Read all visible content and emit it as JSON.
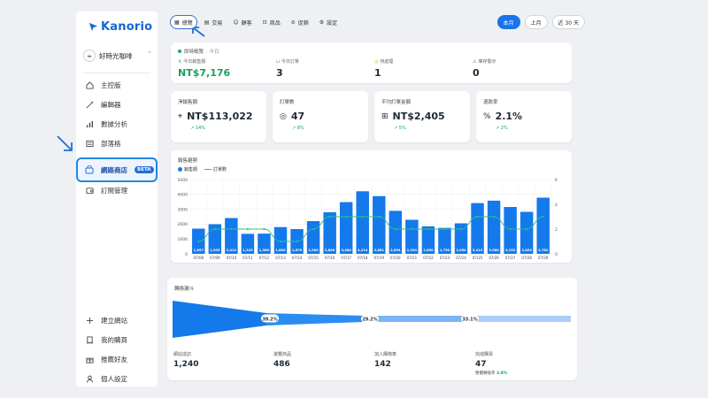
{
  "brand": {
    "name": "Kanorio",
    "accent": "#1a73e8"
  },
  "store": {
    "name": "好時光咖啡"
  },
  "nav": {
    "main": [
      "主控版",
      "編輯器",
      "數據分析",
      "部落格",
      "網路商店",
      "訂閱管理"
    ],
    "active_badge": "BETA",
    "bottom": [
      "建立網站",
      "我的購買",
      "推薦好友",
      "個人設定"
    ]
  },
  "tabs": [
    "總覽",
    "交易",
    "顧客",
    "商品",
    "促銷",
    "設定"
  ],
  "periods": [
    "本月",
    "上月",
    "近 30 天"
  ],
  "live": {
    "title": "即時概覽",
    "suffix": "· 今日",
    "items": [
      {
        "label": "今日銷售額",
        "value": "NT$7,176"
      },
      {
        "label": "今日訂單",
        "value": "3"
      },
      {
        "label": "待處理",
        "value": "1"
      },
      {
        "label": "庫存警示",
        "value": "0"
      }
    ]
  },
  "kpis": [
    {
      "label": "淨銷售額",
      "value": "NT$113,022",
      "delta": "14%"
    },
    {
      "label": "訂單數",
      "value": "47",
      "delta": "8%"
    },
    {
      "label": "平均訂單金額",
      "value": "NT$2,405",
      "delta": "5%"
    },
    {
      "label": "退款率",
      "value": "2.1%",
      "delta": "2%"
    }
  ],
  "chart_data": {
    "type": "bar",
    "title": "銷售趨勢",
    "categories": [
      "07/08",
      "07/09",
      "07/10",
      "07/11",
      "07/12",
      "07/13",
      "07/14",
      "07/15",
      "07/16",
      "07/17",
      "07/18",
      "07/19",
      "07/20",
      "07/21",
      "07/22",
      "07/23",
      "07/24",
      "07/25",
      "07/26",
      "07/27",
      "07/28",
      "07/29"
    ],
    "series": [
      {
        "name": "銷售額",
        "type": "bar",
        "axis": "left",
        "values": [
          1697,
          1995,
          2412,
          1345,
          1360,
          1800,
          1670,
          2200,
          2800,
          3484,
          4214,
          3881,
          2894,
          2290,
          1850,
          1750,
          2050,
          3413,
          3580,
          3152,
          2829,
          3782
        ],
        "labels": [
          "1,697",
          "1,995",
          "2,412",
          "1,345",
          "1,360",
          "1,800",
          "1,670",
          "2,200",
          "2,800",
          "3,484",
          "4,214",
          "3,881",
          "2,894",
          "2,290",
          "1,850",
          "1,750",
          "2,050",
          "3,413",
          "3,580",
          "3,152",
          "2,829",
          "3,782"
        ]
      },
      {
        "name": "訂單數",
        "type": "line",
        "axis": "right",
        "values": [
          1,
          2,
          2,
          2,
          2,
          1,
          1,
          2,
          3,
          3,
          3,
          3,
          2,
          2,
          2,
          2,
          2,
          3,
          3,
          2,
          2,
          3
        ]
      }
    ],
    "ylim": [
      0,
      5000
    ],
    "yticks": [
      0,
      1000,
      2000,
      3000,
      4000,
      5000
    ],
    "y2lim": [
      0,
      6
    ],
    "y2ticks": [
      0,
      2,
      4,
      6
    ],
    "colors": {
      "bar": "#1479ea",
      "line": "#2cc08a"
    }
  },
  "funnel": {
    "title": "轉換漏斗",
    "rates": [
      "39.2%",
      "29.2%",
      "33.1%"
    ],
    "stages": [
      {
        "label": "網站造訪",
        "value": "1,240"
      },
      {
        "label": "瀏覽商品",
        "value": "486"
      },
      {
        "label": "加入購物車",
        "value": "142"
      },
      {
        "label": "完成購買",
        "value": "47",
        "sub_label": "整體轉換率",
        "sub_value": "3.8%"
      }
    ]
  }
}
